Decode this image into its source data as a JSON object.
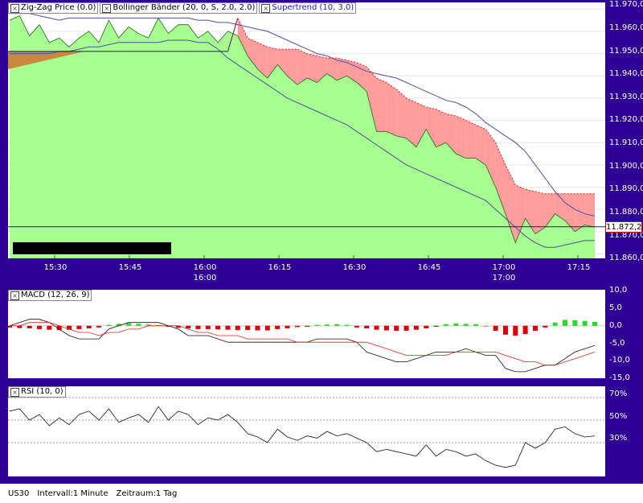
{
  "colors": {
    "frame": "#2e0096",
    "price_fill": "#a6ff8e",
    "supertrend_fill": "#ff9c9c",
    "supertrend_line": "#e02020",
    "bollinger": "#4f4fa0",
    "zigzag": "#1a1a80",
    "macd_pos": "#22dd22",
    "macd_neg": "#dd0000",
    "signal": "#dd2222"
  },
  "main": {
    "legend": [
      {
        "name": "zigzag",
        "label": "Zig-Zag Price (0.0)",
        "blue": false
      },
      {
        "name": "bollinger",
        "label": "Bollinger Bänder (20, 0, S, 2.0, 2.0)",
        "blue": false
      },
      {
        "name": "supertrend",
        "label": "Supertrend (10, 3.0)",
        "blue": true
      }
    ],
    "y_labels": [
      "11.970,0",
      "11.960,0",
      "11.950,0",
      "11.940,0",
      "11.930,0",
      "11.920,0",
      "11.910,0",
      "11.900,0",
      "11.890,0",
      "11.880,0",
      "11.870,0",
      "11.860,0"
    ],
    "current_price": "11.872,2",
    "x_labels": [
      {
        "time": "15:30",
        "date": ""
      },
      {
        "time": "15:45",
        "date": ""
      },
      {
        "time": "16:00",
        "date": "16:00"
      },
      {
        "time": "16:15",
        "date": ""
      },
      {
        "time": "16:30",
        "date": ""
      },
      {
        "time": "16:45",
        "date": ""
      },
      {
        "time": "17:00",
        "date": "17:00"
      },
      {
        "time": "17:15",
        "date": ""
      }
    ]
  },
  "macd": {
    "legend": "MACD (12, 26, 9)",
    "y_labels": [
      "10,0",
      "5,0",
      "0,0",
      "-5,0",
      "-10,0",
      "-15,0"
    ]
  },
  "rsi": {
    "legend": "RSI (10, 0)",
    "y_labels": [
      "70%",
      "50%",
      "30%"
    ]
  },
  "status": {
    "symbol": "US30",
    "interval": "Intervall:1 Minute",
    "period": "Zeitraum:1 Tag"
  },
  "chart_data": [
    {
      "type": "area",
      "title": "",
      "ylim": [
        11858,
        11973
      ],
      "x": [
        "15:20",
        "15:22",
        "15:24",
        "15:26",
        "15:28",
        "15:30",
        "15:32",
        "15:34",
        "15:36",
        "15:38",
        "15:40",
        "15:42",
        "15:44",
        "15:46",
        "15:48",
        "15:50",
        "15:52",
        "15:54",
        "15:56",
        "15:58",
        "16:00",
        "16:02",
        "16:04",
        "16:06",
        "16:08",
        "16:10",
        "16:12",
        "16:14",
        "16:16",
        "16:18",
        "16:20",
        "16:22",
        "16:24",
        "16:26",
        "16:28",
        "16:30",
        "16:32",
        "16:34",
        "16:36",
        "16:38",
        "16:40",
        "16:42",
        "16:44",
        "16:46",
        "16:48",
        "16:50",
        "16:52",
        "16:54",
        "16:56",
        "16:58",
        "17:00",
        "17:02",
        "17:04",
        "17:06",
        "17:08",
        "17:10",
        "17:12",
        "17:14",
        "17:16",
        "17:18"
      ],
      "series": [
        {
          "values": [
            11965,
            11967,
            11958,
            11963,
            11955,
            11957,
            11953,
            11957,
            11960,
            11955,
            11965,
            11957,
            11962,
            11959,
            11957,
            11966,
            11959,
            11963,
            11963,
            11957,
            11960,
            11955,
            11960,
            11958,
            11949,
            11943,
            11939,
            11945,
            11940,
            11936,
            11939,
            11937,
            11941,
            11938,
            11940,
            11937,
            11933,
            11915,
            11915,
            11913,
            11912,
            11908,
            11916,
            11908,
            11910,
            11905,
            11903,
            11903,
            11900,
            11890,
            11878,
            11865,
            11876,
            11869,
            11872,
            11878,
            11875,
            11870,
            11873,
            11872
          ]
        },
        {
          "values": [
            11951,
            11951,
            11951,
            11951,
            11951,
            11951,
            11951,
            11951,
            11951,
            11951,
            11951,
            11951,
            11951,
            11951,
            11951,
            11951,
            11951,
            11951,
            11951,
            11951,
            11951,
            11951,
            11951,
            11966,
            11957,
            11955,
            11953,
            11952,
            11952,
            11952,
            11950,
            11949,
            11948,
            11948,
            11947,
            11946,
            11944,
            11939,
            11937,
            11934,
            11930,
            11928,
            11926,
            11925,
            11923,
            11922,
            11920,
            11918,
            11916,
            11910,
            11900,
            11891,
            11889,
            11888,
            11887,
            11887,
            11887,
            11887,
            11887,
            11887
          ]
        },
        {
          "values": [
            11968,
            11968,
            11968,
            11967,
            11966,
            11965,
            11966,
            11966,
            11966,
            11966,
            11966,
            11966,
            11966,
            11966,
            11966,
            11966,
            11966,
            11966,
            11966,
            11965,
            11965,
            11964,
            11964,
            11963,
            11962,
            11961,
            11960,
            11958,
            11956,
            11954,
            11952,
            11950,
            11949,
            11947,
            11946,
            11944,
            11942,
            11941,
            11940,
            11939,
            11937,
            11935,
            11933,
            11931,
            11929,
            11928,
            11926,
            11923,
            11919,
            11916,
            11913,
            11910,
            11906,
            11900,
            11894,
            11888,
            11883,
            11880,
            11878,
            11877
          ]
        },
        {
          "values": [
            11950,
            11950,
            11950,
            11950,
            11950,
            11951,
            11951,
            11952,
            11953,
            11953,
            11954,
            11955,
            11955,
            11955,
            11955,
            11955,
            11956,
            11956,
            11956,
            11955,
            11955,
            11952,
            11948,
            11945,
            11942,
            11939,
            11936,
            11933,
            11930,
            11928,
            11926,
            11924,
            11922,
            11920,
            11918,
            11915,
            11912,
            11909,
            11906,
            11903,
            11900,
            11898,
            11896,
            11894,
            11892,
            11890,
            11888,
            11886,
            11884,
            11880,
            11876,
            11872,
            11868,
            11865,
            11863,
            11863,
            11864,
            11865,
            11866,
            11866
          ]
        }
      ]
    },
    {
      "type": "bar",
      "title": "",
      "ylim": [
        -16,
        11
      ],
      "x": [
        "15:20",
        "15:22",
        "15:24",
        "15:26",
        "15:28",
        "15:30",
        "15:32",
        "15:34",
        "15:36",
        "15:38",
        "15:40",
        "15:42",
        "15:44",
        "15:46",
        "15:48",
        "15:50",
        "15:52",
        "15:54",
        "15:56",
        "15:58",
        "16:00",
        "16:02",
        "16:04",
        "16:06",
        "16:08",
        "16:10",
        "16:12",
        "16:14",
        "16:16",
        "16:18",
        "16:20",
        "16:22",
        "16:24",
        "16:26",
        "16:28",
        "16:30",
        "16:32",
        "16:34",
        "16:36",
        "16:38",
        "16:40",
        "16:42",
        "16:44",
        "16:46",
        "16:48",
        "16:50",
        "16:52",
        "16:54",
        "16:56",
        "16:58",
        "17:00",
        "17:02",
        "17:04",
        "17:06",
        "17:08",
        "17:10",
        "17:12",
        "17:14",
        "17:16",
        "17:18"
      ],
      "series": [
        {
          "values": [
            -0.5,
            -0.7,
            -0.8,
            -1.0,
            -1.2,
            -1.3,
            -1.2,
            -1.0,
            -0.8,
            -0.5,
            0.3,
            0.6,
            0.8,
            0.6,
            0.4,
            0.2,
            -0.3,
            -0.6,
            -0.8,
            -1.0,
            -1.0,
            -1.1,
            -1.2,
            -1.3,
            -1.3,
            -1.4,
            -1.4,
            -1.0,
            -0.8,
            -0.4,
            -0.3,
            0.3,
            0.4,
            0.5,
            0.3,
            -0.5,
            -0.8,
            -1.2,
            -1.4,
            -1.5,
            -1.5,
            -1.2,
            -0.8,
            -0.3,
            0.5,
            0.7,
            0.6,
            0.5,
            0.0,
            -1.5,
            -2.7,
            -3.0,
            -2.5,
            -1.5,
            -0.5,
            1.0,
            1.8,
            1.7,
            1.5,
            1.2
          ]
        },
        {
          "values": [
            0,
            1,
            2,
            2,
            1,
            -1,
            -3,
            -4,
            -4,
            -4,
            -1,
            0,
            1,
            1,
            1,
            1,
            0,
            -1,
            -3,
            -3,
            -3,
            -4,
            -5,
            -5,
            -5,
            -5,
            -5,
            -5,
            -5,
            -5,
            -5,
            -4,
            -4,
            -4,
            -4,
            -5,
            -8,
            -9,
            -10,
            -11,
            -11,
            -10,
            -9,
            -8,
            -8,
            -8,
            -7,
            -8,
            -9,
            -9,
            -13,
            -14,
            -14,
            -13,
            -12,
            -12,
            -10,
            -8,
            -7,
            -6
          ]
        },
        {
          "values": [
            0,
            0,
            1,
            1,
            1,
            0,
            -1,
            -2,
            -2,
            -3,
            -2,
            -2,
            -1,
            -1,
            0,
            0,
            0,
            0,
            -1,
            -2,
            -2,
            -3,
            -3,
            -3,
            -4,
            -4,
            -4,
            -4,
            -4,
            -5,
            -5,
            -5,
            -5,
            -5,
            -5,
            -5,
            -5,
            -6,
            -7,
            -8,
            -9,
            -9,
            -9,
            -9,
            -9,
            -8,
            -8,
            -8,
            -8,
            -8,
            -9,
            -10,
            -11,
            -11,
            -12,
            -12,
            -11,
            -10,
            -9,
            -8
          ]
        }
      ]
    },
    {
      "type": "line",
      "title": "",
      "ylim": [
        0,
        80
      ],
      "x": [
        "15:20",
        "15:22",
        "15:24",
        "15:26",
        "15:28",
        "15:30",
        "15:32",
        "15:34",
        "15:36",
        "15:38",
        "15:40",
        "15:42",
        "15:44",
        "15:46",
        "15:48",
        "15:50",
        "15:52",
        "15:54",
        "15:56",
        "15:58",
        "16:00",
        "16:02",
        "16:04",
        "16:06",
        "16:08",
        "16:10",
        "16:12",
        "16:14",
        "16:16",
        "16:18",
        "16:20",
        "16:22",
        "16:24",
        "16:26",
        "16:28",
        "16:30",
        "16:32",
        "16:34",
        "16:36",
        "16:38",
        "16:40",
        "16:42",
        "16:44",
        "16:46",
        "16:48",
        "16:50",
        "16:52",
        "16:54",
        "16:56",
        "16:58",
        "17:00",
        "17:02",
        "17:04",
        "17:06",
        "17:08",
        "17:10",
        "17:12",
        "17:14",
        "17:16",
        "17:18"
      ],
      "series": [
        {
          "values": [
            58,
            60,
            50,
            55,
            45,
            52,
            46,
            55,
            58,
            50,
            60,
            48,
            52,
            55,
            48,
            62,
            50,
            58,
            55,
            46,
            52,
            50,
            55,
            48,
            38,
            35,
            30,
            42,
            35,
            32,
            36,
            34,
            40,
            36,
            38,
            34,
            30,
            22,
            24,
            22,
            20,
            18,
            28,
            18,
            24,
            22,
            18,
            20,
            14,
            10,
            8,
            10,
            30,
            25,
            30,
            42,
            44,
            38,
            35,
            36
          ]
        }
      ]
    }
  ]
}
